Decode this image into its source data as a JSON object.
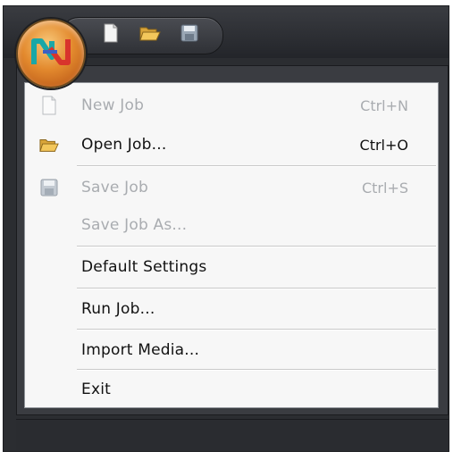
{
  "quick_access": {
    "buttons": [
      {
        "name": "new-icon"
      },
      {
        "name": "open-folder-icon"
      },
      {
        "name": "save-icon"
      }
    ]
  },
  "app_menu": {
    "items": [
      {
        "label": "New Job",
        "shortcut": "Ctrl+N",
        "enabled": false,
        "icon": "new-document-icon"
      },
      {
        "label": "Open Job...",
        "shortcut": "Ctrl+O",
        "enabled": true,
        "icon": "open-folder-icon"
      },
      {
        "label": "Save Job",
        "shortcut": "Ctrl+S",
        "enabled": false,
        "icon": "floppy-disk-icon"
      },
      {
        "label": "Save Job As...",
        "shortcut": "",
        "enabled": false,
        "icon": ""
      },
      {
        "label": "Default Settings",
        "shortcut": "",
        "enabled": true,
        "icon": ""
      },
      {
        "label": "Run Job...",
        "shortcut": "",
        "enabled": true,
        "icon": ""
      },
      {
        "label": "Import Media...",
        "shortcut": "",
        "enabled": true,
        "icon": ""
      },
      {
        "label": "Exit",
        "shortcut": "",
        "enabled": true,
        "icon": ""
      }
    ]
  },
  "colors": {
    "frame": "#2b2d31",
    "menu_bg": "#f7f7f7",
    "disabled_text": "#a9acb0",
    "orb": "#e38a2e"
  }
}
